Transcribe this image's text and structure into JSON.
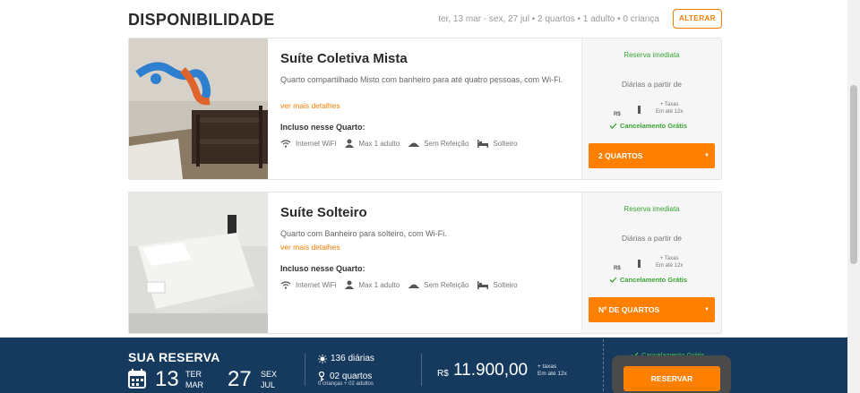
{
  "header": {
    "title": "DISPONIBILIDADE",
    "summary": "ter, 13 mar - sex, 27 jul • 2 quartos • 1 adulto • 0 criança",
    "alter_label": "ALTERAR"
  },
  "rooms": [
    {
      "name": "Suíte Coletiva Mista",
      "description": "Quarto compartilhado Misto com banheiro para até quatro pessoas, com Wi-Fi.",
      "more_link": "ver mais detalhes",
      "included_label": "Incluso nesse Quarto:",
      "amenities": [
        {
          "icon": "wifi-icon",
          "label": "Internet WiFi"
        },
        {
          "icon": "person-icon",
          "label": "Max 1 adulto"
        },
        {
          "icon": "meal-icon",
          "label": "Sem Refeição"
        },
        {
          "icon": "bed-icon",
          "label": "Solteiro"
        }
      ],
      "price": {
        "immediate": "Reserva imediata",
        "from_label": "Diárias a partir de",
        "currency": "R$",
        "tax_line1": "+ Taxas",
        "tax_line2": "Em até 12x",
        "cancel": "Cancelamento Grátis"
      },
      "select_label": "2 QUARTOS",
      "select_arrow": "▼"
    },
    {
      "name": "Suíte Solteiro",
      "description": "Quarto com Banheiro para solteiro, com Wi-Fi.",
      "more_link": "ver mais detalhes",
      "included_label": "Incluso nesse Quarto:",
      "amenities": [
        {
          "icon": "wifi-icon",
          "label": "Internet WiFi"
        },
        {
          "icon": "person-icon",
          "label": "Max 1 adulto"
        },
        {
          "icon": "meal-icon",
          "label": "Sem Refeição"
        },
        {
          "icon": "bed-icon",
          "label": "Solteiro"
        }
      ],
      "price": {
        "immediate": "Reserva imediata",
        "from_label": "Diárias a partir de",
        "currency": "R$",
        "tax_line1": "+ Taxas",
        "tax_line2": "Em até 12x",
        "cancel": "Cancelamento Grátis"
      },
      "select_label": "Nº DE QUARTOS",
      "select_arrow": "▼"
    }
  ],
  "reservation": {
    "title": "SUA RESERVA",
    "checkin": {
      "day": "13",
      "weekday": "TER",
      "month": "MAR"
    },
    "checkout": {
      "day": "27",
      "weekday": "SEX",
      "month": "JUL"
    },
    "nights": "136 diárias",
    "rooms": "02 quartos",
    "guests": "0 crianças + 02 adultos",
    "currency": "R$",
    "total": "11.900,00",
    "tax_line1": "+ taxas",
    "tax_line2": "Em até 12x",
    "cancel": "Cancelamento Grátis",
    "reserve_label": "RESERVAR"
  },
  "colors": {
    "accent": "#ff7f00",
    "green": "#3aa535",
    "bar": "#153a5e"
  }
}
